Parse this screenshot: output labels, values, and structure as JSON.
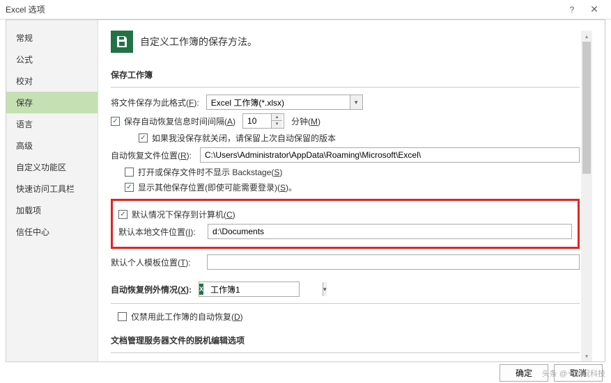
{
  "title": "Excel 选项",
  "sidebar": {
    "items": [
      {
        "label": "常规"
      },
      {
        "label": "公式"
      },
      {
        "label": "校对"
      },
      {
        "label": "保存",
        "active": true
      },
      {
        "label": "语言"
      },
      {
        "label": "高级"
      },
      {
        "label": "自定义功能区"
      },
      {
        "label": "快速访问工具栏"
      },
      {
        "label": "加载项"
      },
      {
        "label": "信任中心"
      }
    ]
  },
  "header": {
    "title": "自定义工作簿的保存方法。"
  },
  "section1": {
    "title": "保存工作簿",
    "format_label_pre": "将文件保存为此格式(",
    "format_label_u": "F",
    "format_label_post": "):",
    "format_value": "Excel 工作簿(*.xlsx)",
    "autorec_check": true,
    "autorec_label_pre": "保存自动恢复信息时间间隔(",
    "autorec_label_u": "A",
    "autorec_label_post": ")",
    "autorec_minutes": "10",
    "minutes_label_pre": "分钟(",
    "minutes_label_u": "M",
    "minutes_label_post": ")",
    "keeplast_check": true,
    "keeplast_label": "如果我没保存就关闭，请保留上次自动保留的版本",
    "autoloc_label_pre": "自动恢复文件位置(",
    "autoloc_label_u": "R",
    "autoloc_label_post": "):",
    "autoloc_value": "C:\\Users\\Administrator\\AppData\\Roaming\\Microsoft\\Excel\\",
    "nobackstage_check": false,
    "nobackstage_label_pre": "打开或保存文件时不显示 Backstage(",
    "nobackstage_label_u": "S",
    "nobackstage_label_post": ")",
    "showother_check": true,
    "showother_label_pre": "显示其他保存位置(即使可能需要登录)(",
    "showother_label_u": "S",
    "showother_label_post": ")。",
    "savetopc_check": true,
    "savetopc_label_pre": "默认情况下保存到计算机(",
    "savetopc_label_u": "C",
    "savetopc_label_post": ")",
    "defloc_label_pre": "默认本地文件位置(",
    "defloc_label_u": "I",
    "defloc_label_post": "):",
    "defloc_value": "d:\\Documents",
    "tmpl_label_pre": "默认个人模板位置(",
    "tmpl_label_u": "T",
    "tmpl_label_post": "):",
    "tmpl_value": ""
  },
  "section2": {
    "title_pre": "自动恢复例外情况(",
    "title_u": "X",
    "title_post": "):",
    "workbook": "工作簿1",
    "disable_check": false,
    "disable_label_pre": "仅禁用此工作簿的自动恢复(",
    "disable_label_u": "D",
    "disable_label_post": ")"
  },
  "section3": {
    "title": "文档管理服务器文件的脱机编辑选项"
  },
  "footer": {
    "ok": "确定",
    "cancel": "取消"
  },
  "watermark": "头条 @一剑侃科技"
}
